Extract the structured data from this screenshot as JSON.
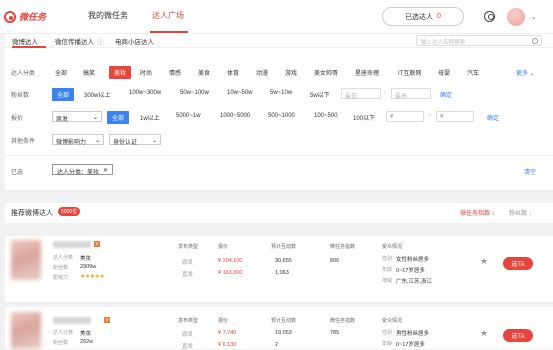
{
  "brand": {
    "name": "微任务"
  },
  "nav": {
    "tabs": [
      "我的微任务",
      "达人广场"
    ],
    "active": 1
  },
  "header": {
    "status_label": "已选达人",
    "status_count": "0"
  },
  "subtabs": [
    "微博达人",
    "微信传播达人",
    "电商小店达人"
  ],
  "subtab_info": "ⓘ",
  "search": {
    "placeholder": "输入达人名称搜索"
  },
  "filters": {
    "category": {
      "label": "达人分类",
      "options": [
        "全部",
        "搞笑",
        "美妆",
        "时尚",
        "情感",
        "美食",
        "体育",
        "动漫",
        "游戏",
        "美女帅哥",
        "星座命理",
        "IT互联网",
        "母婴",
        "汽车"
      ],
      "selected": "美妆",
      "more": "更多"
    },
    "fans": {
      "label": "粉丝数",
      "options": [
        "全部",
        "300w以上",
        "100w~300w",
        "50w~100w",
        "10w~50w",
        "5w~10w",
        "5w以下"
      ],
      "selected": "全部",
      "min_placeholder": "最低",
      "max_placeholder": "最高",
      "confirm": "确定"
    },
    "price": {
      "label": "报价",
      "type_value": "原发",
      "options": [
        "全部",
        "1w以上",
        "5000~1w",
        "1000~5000",
        "500~1000",
        "100~500",
        "100以下"
      ],
      "selected": "全部",
      "confirm": "确定",
      "tilde": "~"
    },
    "other": {
      "label": "其他条件",
      "influence": "微博影响力",
      "auth": "身份认证"
    },
    "chosen": {
      "label": "已选",
      "chip": "达人分类：美妆",
      "clear": "清空"
    }
  },
  "list": {
    "title": "推荐微博达人",
    "count_badge": "5000位",
    "sort_primary": "微任务指数 ↓",
    "sort_secondary": "粉丝数 ↓",
    "columns": [
      "发布类型",
      "报价",
      "预计互动数",
      "微任务指数",
      "受众情况"
    ],
    "cards": [
      {
        "v_label": "V",
        "category_key": "达人分类",
        "category_val": "美妆",
        "fans_key": "粉丝数",
        "fans_val": "2909w",
        "influence_key": "影响力",
        "rating": 5,
        "rows": [
          {
            "type": "原发",
            "price": "¥ 204,100",
            "interact": "30,655"
          },
          {
            "type": "直发",
            "price": "¥ 163,300",
            "interact": "1,063"
          }
        ],
        "index": "806",
        "audience": [
          {
            "k": "性别",
            "v": "女性粉丝居多"
          },
          {
            "k": "年龄",
            "v": "0~17岁居多"
          },
          {
            "k": "地域",
            "v": "广东,江苏,浙江"
          }
        ],
        "add_label": "选TA"
      },
      {
        "v_label": "V",
        "category_key": "达人分类",
        "category_val": "美妆",
        "fans_key": "粉丝数",
        "fans_val": "292w",
        "rows": [
          {
            "type": "原发",
            "price": "¥ 7,740",
            "interact": "19,053"
          },
          {
            "type": "直发",
            "price": "¥ 6,130",
            "interact": "2"
          }
        ],
        "index": "785",
        "audience": [
          {
            "k": "性别",
            "v": "男性粉丝居多"
          },
          {
            "k": "年龄",
            "v": "0~17岁居多"
          }
        ],
        "add_label": "选TA"
      }
    ]
  },
  "colors": {
    "accent": "#e8453c",
    "link": "#3a83f0"
  }
}
